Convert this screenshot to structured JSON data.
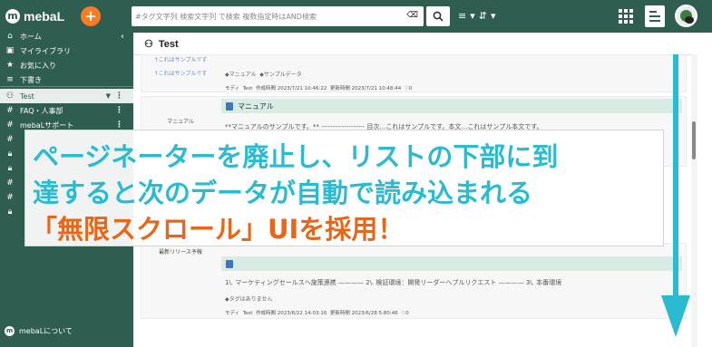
{
  "app": {
    "name": "mebaL",
    "new_button": "+"
  },
  "search": {
    "placeholder": "#タグ文字列 検索文字列 で検索 複数指定時はAND検索",
    "clear": "⌫"
  },
  "sidebar": {
    "items": [
      {
        "icon": "home-icon",
        "label": "ホーム"
      },
      {
        "icon": "library-icon",
        "label": "マイライブラリ"
      },
      {
        "icon": "star-icon",
        "label": "お気に入り"
      },
      {
        "icon": "draft-icon",
        "label": "下書き"
      },
      {
        "icon": "group-icon",
        "label": "Test"
      },
      {
        "icon": "hash-icon",
        "label": "FAQ・人事部"
      },
      {
        "icon": "hash-icon",
        "label": "mebaLサポート"
      }
    ],
    "footer": "mebaLについて"
  },
  "main": {
    "title": "Test",
    "cards": [
      {
        "thumb_text": "↑これはサンプルです",
        "thumb_text2": "↑これはサンプルです",
        "tags": [
          "マニュアル",
          "サンプルデータ"
        ],
        "meta": {
          "author": "モディ",
          "group": "Test",
          "created": "作成時間 2023/7/21 10:46:22",
          "updated": "更新時間 2023/7/21 10:48:44",
          "likes": "0"
        }
      },
      {
        "thumb_text": "マニュアル",
        "title": "マニュアル",
        "body": "**マニュアルのサンプルです。** ------------------- 目次…これはサンプルです。本文…これはサンプル本文です。"
      },
      {
        "thumb_text": "最新リリース予報",
        "body": "1\\. マーケティングセールスへ施策連携 ———— 2\\. 検証環境：開発リーダーへプルリクエスト ———— 3\\. 本番環境",
        "tags": [
          "タグはありません"
        ],
        "meta": {
          "author": "モディ",
          "group": "Test",
          "created": "作成時間 2023/6/22 14:03:16",
          "updated": "更新時間 2023/6/28 5:80:46",
          "likes": "0"
        }
      }
    ]
  },
  "banner": {
    "line1": "ページネーターを廃止し、リストの下部に到",
    "line2": "達すると次のデータが自動で読み込まれる",
    "line3": "「無限スクロール」UIを採用！"
  },
  "colors": {
    "brand": "#2f5d50",
    "accent": "#2bbbd1",
    "highlight": "#e76618",
    "new": "#ff7a22"
  }
}
